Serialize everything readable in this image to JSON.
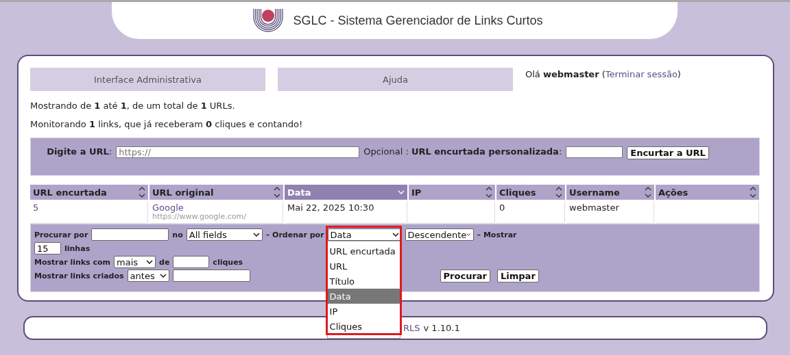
{
  "header": {
    "title": "SGLC - Sistema Gerenciador de Links Curtos"
  },
  "tabs": [
    {
      "label": "Interface Administrativa"
    },
    {
      "label": "Ajuda"
    }
  ],
  "greeting": {
    "before": "Olá **webmaster** (",
    "link": "Terminar sessão",
    "after": ")"
  },
  "summary": [
    "Mostrando de **1** até **1**, de um total de **1** URLs.",
    "Monitorando **1** links, que já receberam **0** cliques e contando!"
  ],
  "add_form": {
    "url_label": "**Digite a URL**:",
    "url_placeholder": "https://",
    "custom_label": "Opcional : **URL encurtada personalizada**:",
    "submit": "Encurtar a URL"
  },
  "table": {
    "columns": [
      {
        "label": "URL encurtada",
        "sorted": false
      },
      {
        "label": "URL original",
        "sorted": false
      },
      {
        "label": "Data",
        "sorted": true
      },
      {
        "label": "IP",
        "sorted": false
      },
      {
        "label": "Cliques",
        "sorted": false
      },
      {
        "label": "Username",
        "sorted": false
      },
      {
        "label": "Ações",
        "sorted": false
      }
    ],
    "rows": [
      {
        "short": "5",
        "title": "Google",
        "url": "https://www.google.com/",
        "date": "Mai 22, 2025 10:30",
        "clicks": "0",
        "username": "webmaster"
      }
    ]
  },
  "filter": {
    "search_label": "Procurar por",
    "in_label": "no",
    "field_select": "All fields",
    "order_label": "– Ordenar por",
    "order_select": "Data",
    "direction_select": "Descendente",
    "show_label": "– Mostrar",
    "rows_value": "15",
    "rows_label": "linhas",
    "clicks_label": "Mostrar links com",
    "clicks_select": "mais",
    "of_label": "de",
    "clicks_unit": "cliques",
    "created_label": "Mostrar links criados",
    "created_select": "antes",
    "search_button": "Procurar",
    "clear_button": "Limpar",
    "order_options": [
      {
        "label": "URL encurtada",
        "selected": false
      },
      {
        "label": "URL",
        "selected": false
      },
      {
        "label": "Título",
        "selected": false
      },
      {
        "label": "Data",
        "selected": true
      },
      {
        "label": "IP",
        "selected": false
      },
      {
        "label": "Cliques",
        "selected": false
      }
    ]
  },
  "footer": {
    "link": "RLS",
    "version": "v 1.10.1"
  }
}
